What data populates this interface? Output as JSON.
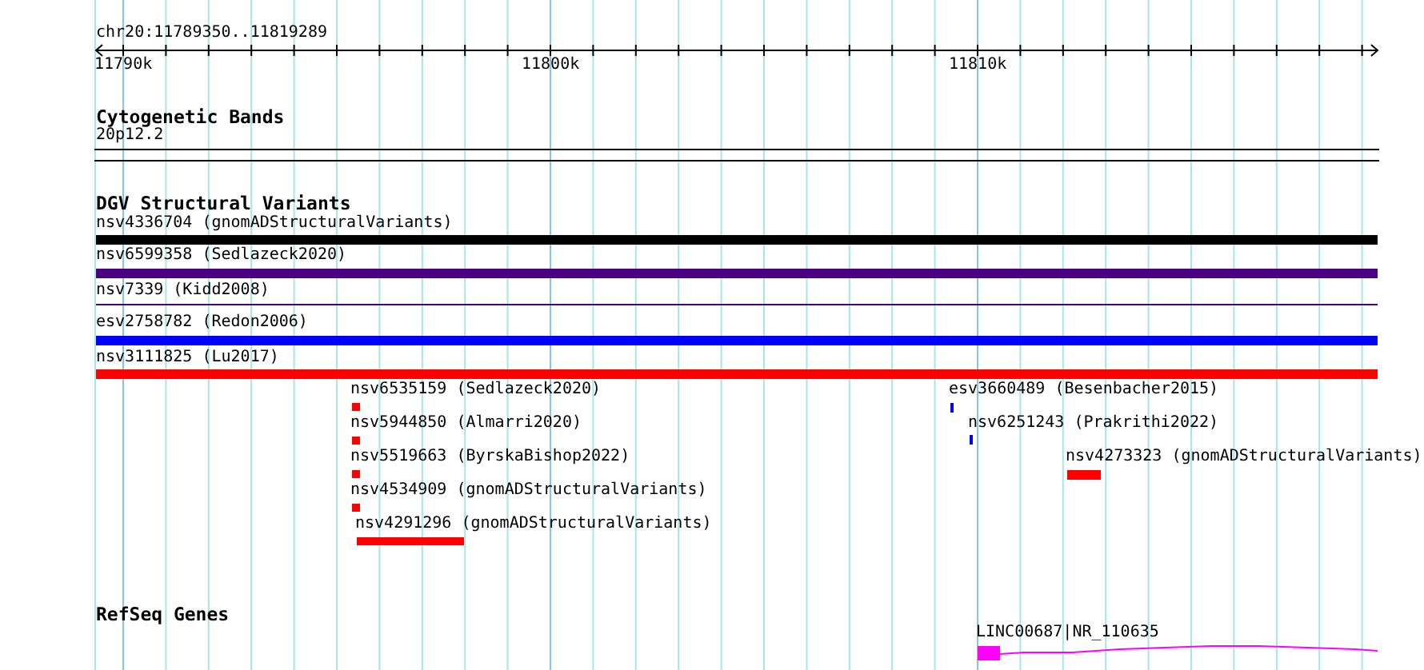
{
  "ruler": {
    "location": "chr20:11789350..11819289",
    "ticks": [
      "11790k",
      "11800k",
      "11810k"
    ]
  },
  "tracks": [
    {
      "kind": "cytoband",
      "title": "Cytogenetic Bands",
      "features": [
        {
          "label": "20p12.2"
        }
      ]
    },
    {
      "kind": "variants",
      "title": "DGV Structural Variants",
      "features": [
        {
          "label": "nsv4336704 (gnomADStructuralVariants)",
          "color": "#000000"
        },
        {
          "label": "nsv6599358 (Sedlazeck2020)",
          "color": "#4b0082"
        },
        {
          "label": "nsv7339 (Kidd2008)",
          "color": "#4b0082"
        },
        {
          "label": "esv2758782 (Redon2006)",
          "color": "#0000ff"
        },
        {
          "label": "nsv3111825 (Lu2017)",
          "color": "#ff0000"
        },
        {
          "label": "nsv6535159 (Sedlazeck2020)",
          "color": "#ff0000"
        },
        {
          "label": "nsv5944850 (Almarri2020)",
          "color": "#ff0000"
        },
        {
          "label": "nsv5519663 (ByrskaBishop2022)",
          "color": "#ff0000"
        },
        {
          "label": "nsv4534909 (gnomADStructuralVariants)",
          "color": "#ff0000"
        },
        {
          "label": "nsv4291296 (gnomADStructuralVariants)",
          "color": "#ff0000"
        },
        {
          "label": "esv3660489 (Besenbacher2015)",
          "color": "#0000ff"
        },
        {
          "label": "nsv6251243 (Prakrithi2022)",
          "color": "#0000ff"
        },
        {
          "label": "nsv4273323 (gnomADStructuralVariants)",
          "color": "#ff0000"
        }
      ]
    },
    {
      "kind": "genes",
      "title": "RefSeq Genes",
      "features": [
        {
          "label": "LINC00687|NR_110635",
          "color": "#ff00ff"
        }
      ]
    }
  ]
}
